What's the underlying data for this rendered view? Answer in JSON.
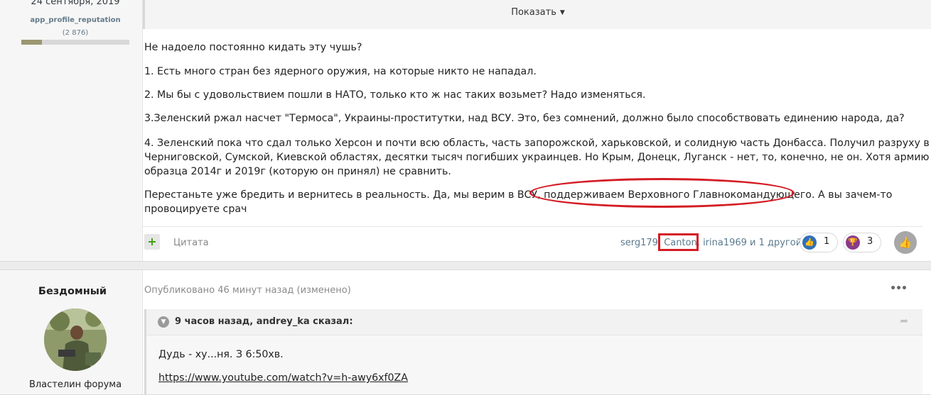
{
  "post1": {
    "author": {
      "join_date": "24 сентября, 2019",
      "reputation_label": "app_profile_reputation",
      "reputation_count": "(2 876)",
      "reputation_fill_fraction": 0.19
    },
    "quote_toggle_label": "Показать",
    "paragraphs": [
      "Не надоело постоянно кидать эту чушь?",
      "1. Есть много стран без ядерного оружия, на которые никто не нападал.",
      "2. Мы бы с удовольствием пошли в НАТО, только кто ж нас таких возьмет? Надо изменяться.",
      "3.Зеленский ржал насчет \"Термоса\", Украины-проститутки, над ВСУ. Это, без сомнений, должно было способствовать единению народа, да?",
      "4. Зеленский пока что сдал только Херсон и почти всю область, часть запорожской, харьковской, и солидную часть Донбасса. Получил разруху в Черниговской, Сумской, Киевской областях, десятки тысяч погибших украинцев.  Но Крым, Донецк, Луганск - нет, то, конечно,  не он.  Хотя армию образца 2014г и 2019г (которую он принял) не сравнить.",
      "Перестаньте уже бредить и вернитесь в реальность. Да, мы верим в ВСУ, поддерживаем Верховного Главнокомандующего. А вы зачем-то провоцируете срач"
    ],
    "footer": {
      "quote_label": "Цитата",
      "likers": {
        "user1": "serg179",
        "sep1": ", ",
        "user2": "Canton",
        "sep2": ", ",
        "user3": "irina1969",
        "others": " и 1 другой"
      },
      "like_count": "1",
      "trophy_count": "3"
    }
  },
  "post2": {
    "author": {
      "name": "Бездомный",
      "title": "Властелин форума"
    },
    "meta": "Опубликовано 46 минут назад (изменено)",
    "quote": {
      "citation": "9 часов назад, andrey_ka сказал:",
      "text": "Дудь - ху...ня.  З 6:50хв.",
      "link": "https://www.youtube.com/watch?v=h-awy6xf0ZA"
    }
  },
  "colors": {
    "annotation_red": "#d41c24",
    "link_blue": "#5a7a8e",
    "like_blue": "#2f70b8",
    "trophy_purple": "#8b3a8b"
  }
}
